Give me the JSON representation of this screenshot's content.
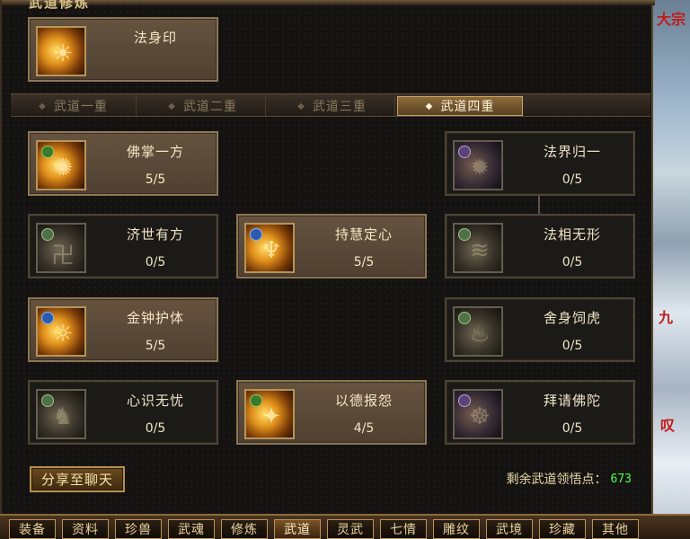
{
  "panel": {
    "title": "武道修炼"
  },
  "top_skill": {
    "name": "法身印",
    "icon": "golden-seal-icon"
  },
  "tabs": [
    {
      "label": "武道一重"
    },
    {
      "label": "武道二重"
    },
    {
      "label": "武道三重"
    },
    {
      "label": "武道四重",
      "active": true
    }
  ],
  "skills": {
    "fozhang": {
      "name": "佛掌一方",
      "level": "5/5",
      "icon": "buddha-palm-icon"
    },
    "fajie": {
      "name": "法界归一",
      "level": "0/5",
      "icon": "dharma-realm-icon"
    },
    "jishi": {
      "name": "济世有方",
      "level": "0/5",
      "icon": "swastika-icon"
    },
    "chihui": {
      "name": "持慧定心",
      "level": "5/5",
      "icon": "wisdom-heart-icon"
    },
    "faxiang": {
      "name": "法相无形",
      "level": "0/5",
      "icon": "formless-icon"
    },
    "jinzhong": {
      "name": "金钟护体",
      "level": "5/5",
      "icon": "golden-bell-icon"
    },
    "sheshen": {
      "name": "舍身饲虎",
      "level": "0/5",
      "icon": "tiger-icon"
    },
    "xinshi": {
      "name": "心识无忧",
      "level": "0/5",
      "icon": "mind-icon"
    },
    "yide": {
      "name": "以德报怨",
      "level": "4/5",
      "icon": "virtue-icon"
    },
    "baiqing": {
      "name": "拜请佛陀",
      "level": "0/5",
      "icon": "buddha-icon"
    }
  },
  "share_button": {
    "label": "分享至聊天"
  },
  "points": {
    "label": "剩余武道领悟点：",
    "value": "673"
  },
  "bottom_nav": [
    {
      "label": "装备"
    },
    {
      "label": "资料"
    },
    {
      "label": "珍兽"
    },
    {
      "label": "武魂"
    },
    {
      "label": "修炼"
    },
    {
      "label": "武道",
      "active": true
    },
    {
      "label": "灵武"
    },
    {
      "label": "七情"
    },
    {
      "label": "雕纹"
    },
    {
      "label": "武境"
    },
    {
      "label": "珍藏"
    },
    {
      "label": "其他"
    }
  ],
  "colors": {
    "accent_gold": "#b89459",
    "points_value": "#4cff4c"
  }
}
